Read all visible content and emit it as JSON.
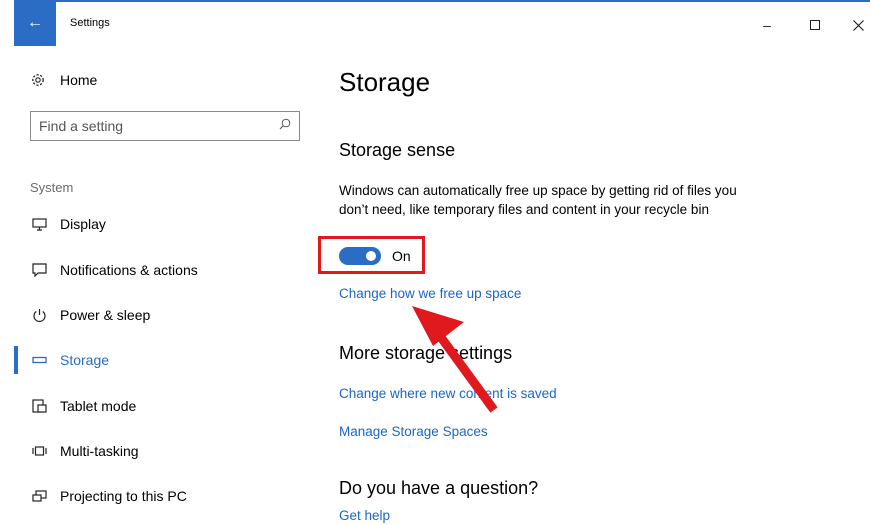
{
  "window": {
    "title": "Settings",
    "back_glyph": "←",
    "minimize_glyph": "–",
    "maximize_glyph": "☐",
    "close_glyph": "✕",
    "accent_color": "#2b6cc4"
  },
  "sidebar": {
    "home_label": "Home",
    "search": {
      "placeholder": "Find a setting",
      "value": ""
    },
    "section_label": "System",
    "items": [
      {
        "label": "Display",
        "icon": "display-icon",
        "selected": false
      },
      {
        "label": "Notifications & actions",
        "icon": "notifications-icon",
        "selected": false
      },
      {
        "label": "Power & sleep",
        "icon": "power-icon",
        "selected": false
      },
      {
        "label": "Storage",
        "icon": "storage-icon",
        "selected": true
      },
      {
        "label": "Tablet mode",
        "icon": "tablet-mode-icon",
        "selected": false
      },
      {
        "label": "Multi-tasking",
        "icon": "multitasking-icon",
        "selected": false
      },
      {
        "label": "Projecting to this PC",
        "icon": "projecting-icon",
        "selected": false
      }
    ]
  },
  "main": {
    "title": "Storage",
    "storage_sense": {
      "heading": "Storage sense",
      "description": "Windows can automatically free up space by getting rid of files you don’t need, like temporary files and content in your recycle bin",
      "toggle_state": "On",
      "toggle_on": true,
      "link": "Change how we free up space"
    },
    "more_settings": {
      "heading": "More storage settings",
      "links": [
        "Change where new content is saved",
        "Manage Storage Spaces"
      ]
    },
    "question": {
      "heading": "Do you have a question?",
      "link": "Get help"
    }
  },
  "annotations": {
    "highlight_box_color": "#e0191f",
    "arrow_color": "#e0191f"
  }
}
